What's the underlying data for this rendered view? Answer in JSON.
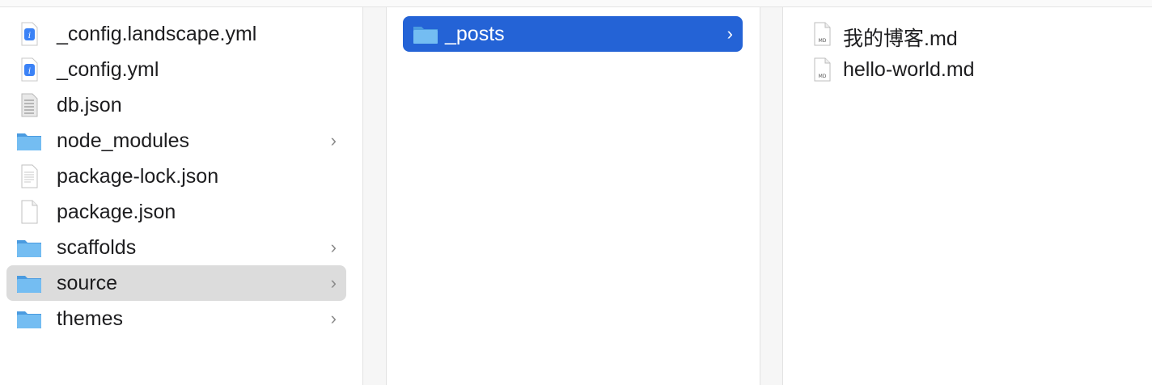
{
  "columns": {
    "col1": {
      "items": [
        {
          "name": "_config.landscape.yml",
          "icon": "yaml-file-icon",
          "folder": false
        },
        {
          "name": "_config.yml",
          "icon": "yaml-file-icon",
          "folder": false
        },
        {
          "name": "db.json",
          "icon": "json-file-icon",
          "folder": false
        },
        {
          "name": "node_modules",
          "icon": "folder-icon",
          "folder": true
        },
        {
          "name": "package-lock.json",
          "icon": "text-file-icon",
          "folder": false
        },
        {
          "name": "package.json",
          "icon": "text-file-icon",
          "folder": false
        },
        {
          "name": "scaffolds",
          "icon": "folder-icon",
          "folder": true
        },
        {
          "name": "source",
          "icon": "folder-icon",
          "folder": true,
          "selected": "inactive"
        },
        {
          "name": "themes",
          "icon": "folder-icon",
          "folder": true
        }
      ]
    },
    "col2": {
      "items": [
        {
          "name": "_posts",
          "icon": "folder-icon",
          "folder": true,
          "selected": "active"
        }
      ]
    },
    "col3": {
      "items": [
        {
          "name": "我的博客.md",
          "icon": "markdown-file-icon",
          "folder": false,
          "badge": "MD"
        },
        {
          "name": "hello-world.md",
          "icon": "markdown-file-icon",
          "folder": false,
          "badge": "MD"
        }
      ]
    }
  },
  "colors": {
    "selection_active": "#2463d6",
    "selection_inactive": "#dcdcdc",
    "folder_blue": "#5aa9e6"
  }
}
